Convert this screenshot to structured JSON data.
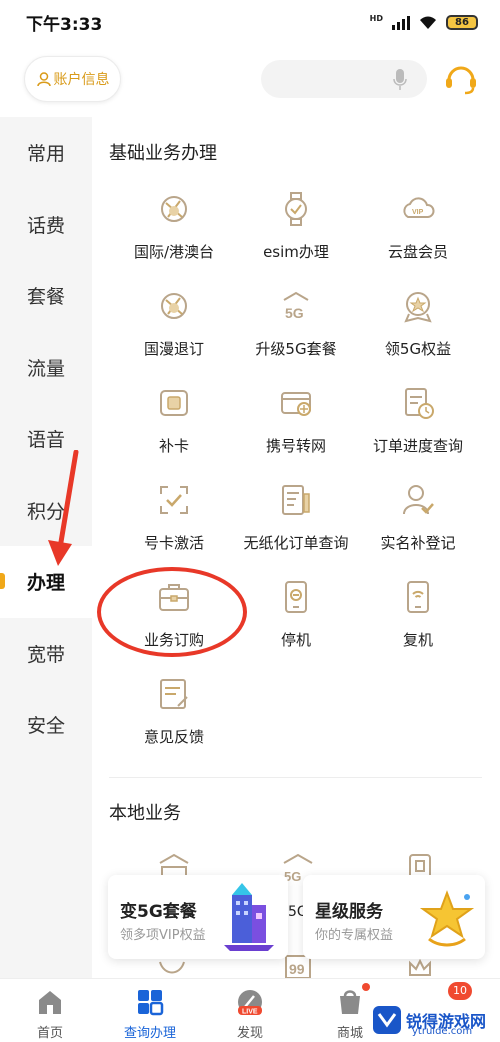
{
  "status_bar": {
    "time": "下午3:33",
    "network": "HD",
    "battery": "86"
  },
  "header": {
    "account_label": "账户信息",
    "search_placeholder": ""
  },
  "sidebar": {
    "items": [
      {
        "label": "常用"
      },
      {
        "label": "话费"
      },
      {
        "label": "套餐"
      },
      {
        "label": "流量"
      },
      {
        "label": "语音"
      },
      {
        "label": "积分"
      },
      {
        "label": "办理",
        "active": true
      },
      {
        "label": "宽带"
      },
      {
        "label": "安全"
      }
    ]
  },
  "main": {
    "section1_title": "基础业务办理",
    "items": [
      {
        "label": "国际/港澳台",
        "icon": "globe-icon"
      },
      {
        "label": "esim办理",
        "icon": "watch-icon"
      },
      {
        "label": "云盘会员",
        "icon": "vip-cloud-icon"
      },
      {
        "label": "国漫退订",
        "icon": "roaming-icon"
      },
      {
        "label": "升级5G套餐",
        "icon": "5g-icon"
      },
      {
        "label": "领5G权益",
        "icon": "medal-icon"
      },
      {
        "label": "补卡",
        "icon": "sim-card-icon"
      },
      {
        "label": "携号转网",
        "icon": "transfer-card-icon"
      },
      {
        "label": "订单进度查询",
        "icon": "clipboard-clock-icon"
      },
      {
        "label": "号卡激活",
        "icon": "scan-check-icon"
      },
      {
        "label": "无纸化订单查询",
        "icon": "paper-pen-icon"
      },
      {
        "label": "实名补登记",
        "icon": "person-check-icon"
      },
      {
        "label": "业务订购",
        "icon": "briefcase-icon"
      },
      {
        "label": "停机",
        "icon": "phone-stop-icon"
      },
      {
        "label": "复机",
        "icon": "phone-wifi-icon"
      },
      {
        "label": "意见反馈",
        "icon": "feedback-icon"
      }
    ],
    "section2_title": "本地业务",
    "local_partial_labels": [
      "5G"
    ]
  },
  "promos": [
    {
      "title": "变5G套餐",
      "subtitle": "领多项VIP权益"
    },
    {
      "title": "星级服务",
      "subtitle": "你的专属权益"
    }
  ],
  "bottom_nav": {
    "items": [
      {
        "label": "首页",
        "icon": "home-icon"
      },
      {
        "label": "查询办理",
        "icon": "grid-icon",
        "active": true
      },
      {
        "label": "发现",
        "icon": "live-icon",
        "badge_text": "LIVE"
      },
      {
        "label": "商城",
        "icon": "shopping-bag-icon"
      }
    ],
    "count_badge": "10"
  },
  "watermark": {
    "text": "锐得游戏网",
    "url": "ytruide.com"
  },
  "colors": {
    "accent": "#f0a819",
    "icon_gold": "#c9a86b",
    "nav_active": "#1a64d8",
    "annotation_red": "#e83828"
  }
}
